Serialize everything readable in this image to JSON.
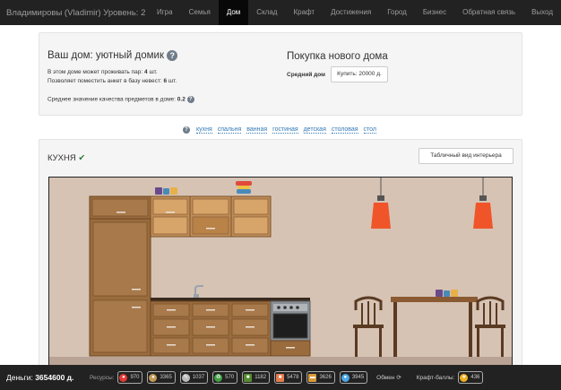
{
  "header": {
    "brand": "Владимировы (Vladimir) Уровень: 2",
    "nav": [
      "Игра",
      "Семья",
      "Дом",
      "Склад",
      "Крафт",
      "Достижения",
      "Город",
      "Бизнес",
      "Обратная связь",
      "Выход"
    ],
    "active": "Дом"
  },
  "house": {
    "title": "Ваш дом: уютный домик",
    "couples_text": "В этом доме может проживать пар:",
    "couples": "4",
    "couples_unit": "шт.",
    "brides_text": "Позволяет поместить анкет в базу невест:",
    "brides": "6",
    "brides_unit": "шт.",
    "quality_text": "Среднее значение качества предметов в доме:",
    "quality": "0.2"
  },
  "buy": {
    "title": "Покупка нового дома",
    "avg_label": "Средний дом",
    "button": "Купить: 20000 д."
  },
  "rooms": [
    "кухня",
    "спальня",
    "ванная",
    "гостиная",
    "детская",
    "столовая",
    "стол"
  ],
  "room": {
    "title": "КУХНЯ",
    "check": "✔",
    "table_view": "Табличный вид интерьера"
  },
  "footer": {
    "money_label": "Деньги:",
    "money": "3654600 д.",
    "resources_label": "Ресурсы:",
    "resources": [
      {
        "icon": "apple-icon",
        "value": "970",
        "color": "#e53935"
      },
      {
        "icon": "bread-icon",
        "value": "3365",
        "color": "#c49a57"
      },
      {
        "icon": "pencil-icon",
        "value": "1037",
        "color": "#bbbbbb"
      },
      {
        "icon": "recycle-icon",
        "value": "570",
        "color": "#43a047"
      },
      {
        "icon": "book-icon",
        "value": "1182",
        "color": "#558b2f"
      },
      {
        "icon": "brick-icon",
        "value": "5478",
        "color": "#e57b4d"
      },
      {
        "icon": "wood-icon",
        "value": "3626",
        "color": "#d89a3a"
      },
      {
        "icon": "drop-icon",
        "value": "3945",
        "color": "#4aa8e6"
      }
    ],
    "exchange": "Обмен",
    "craft_label": "Крафт-баллы:",
    "craft": "436"
  },
  "colors": {
    "wall": "#d6c3b4",
    "cabinet": "#9a6b3d",
    "cabinet_upper": "#c08c56",
    "lamp": "#f0552a"
  }
}
